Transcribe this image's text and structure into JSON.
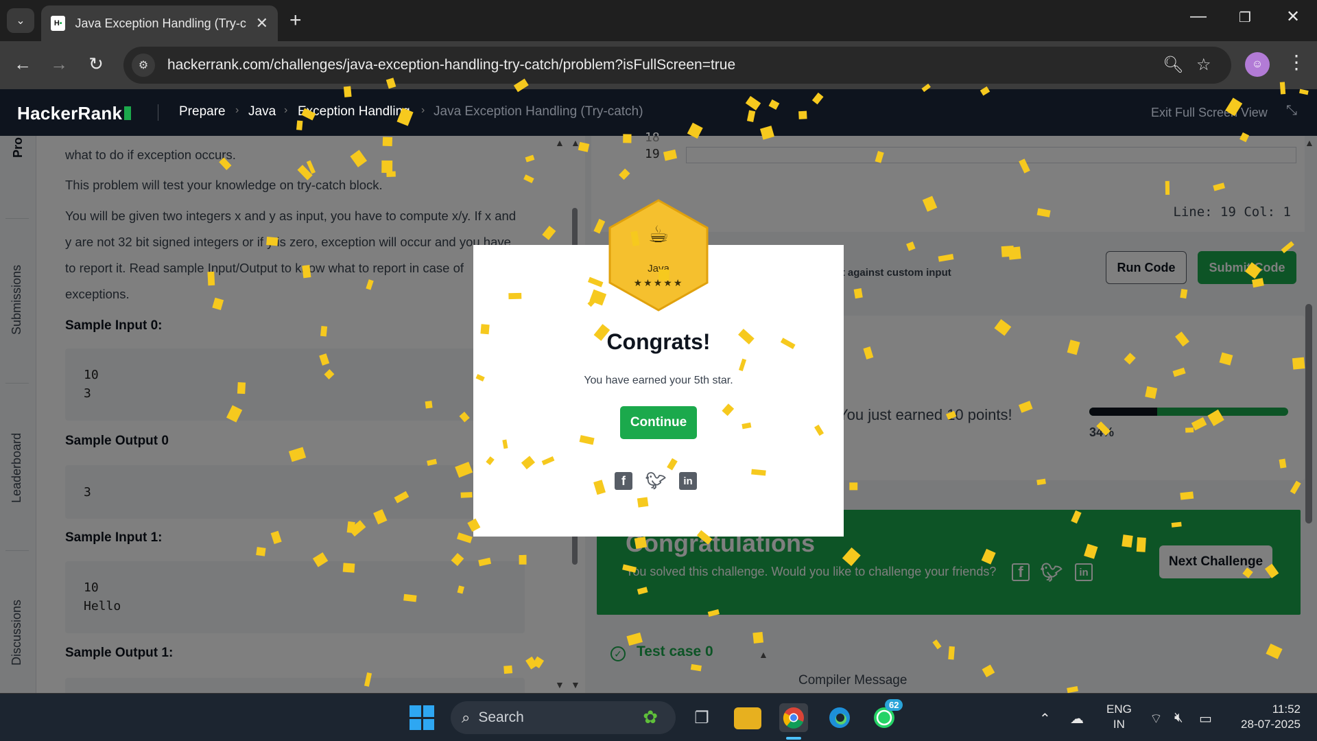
{
  "browser": {
    "tab_title": "Java Exception Handling (Try-ca",
    "url": "hackerrank.com/challenges/java-exception-handling-try-catch/problem?isFullScreen=true",
    "favicon_text": "H",
    "new_tab_label": "+",
    "close_label": "✕"
  },
  "hr_header": {
    "logo": "HackerRank",
    "breadcrumbs": [
      "Prepare",
      "Java",
      "Exception Handling",
      "Java Exception Handling (Try-catch)"
    ],
    "exit_fullscreen": "Exit Full Screen View"
  },
  "side_rail": {
    "problem": "Pro",
    "submissions": "Submissions",
    "leaderboard": "Leaderboard",
    "discussions": "Discussions"
  },
  "problem": {
    "line1": "what to do if exception occurs.",
    "line2": "This problem will test your knowledge on try-catch block.",
    "para": "You will be given two integers x and y as input, you have to compute x/y. If x and y are not 32 bit signed integers or if y is zero, exception will occur and you have to report it. Read sample Input/Output to know what to report in case of exceptions.",
    "sample_input_0_label": "Sample Input 0:",
    "sample_input_0": [
      "10",
      "3"
    ],
    "sample_output_0_label": "Sample Output 0",
    "sample_output_0": [
      "3"
    ],
    "sample_input_1_label": "Sample Input 1:",
    "sample_input_1": [
      "10",
      "Hello"
    ],
    "sample_output_1_label": "Sample Output 1:"
  },
  "editor": {
    "line_prev": "18",
    "line_current": "19",
    "status": "Line: 19  Col: 1",
    "custom_input": "Test against custom input",
    "run_code": "Run Code",
    "submit_code": "Submit Code"
  },
  "score": {
    "points_text": "You just earned 10 points!",
    "progress_percent": 34,
    "progress_label": "34%"
  },
  "congrats_banner": {
    "title": "Congratulations",
    "subtitle": "You solved this challenge. Would you like to challenge your friends?",
    "next_challenge": "Next Challenge"
  },
  "results": {
    "test_case": "Test case 0",
    "compiler_message": "Compiler Message"
  },
  "modal": {
    "badge_name": "Java",
    "badge_stars": "★★★★★",
    "title": "Congrats!",
    "subtitle": "You have earned your 5th star.",
    "continue": "Continue"
  },
  "taskbar": {
    "search_label": "Search",
    "whatsapp_badge": "62",
    "lang_1": "ENG",
    "lang_2": "IN",
    "time": "11:52",
    "date": "28-07-2025"
  },
  "colors": {
    "hr_green": "#1ba94c",
    "hr_dark": "#0e141e",
    "badge_gold": "#f5c02e",
    "confetti": "#f6c91e"
  }
}
